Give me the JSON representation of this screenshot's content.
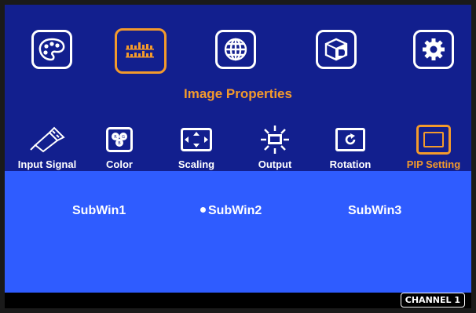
{
  "top_menu": {
    "items": [
      {
        "icon": "palette-icon"
      },
      {
        "icon": "image-properties-icon",
        "active": true
      },
      {
        "icon": "globe-icon"
      },
      {
        "icon": "3d-cube-icon"
      },
      {
        "icon": "gear-icon"
      }
    ],
    "caption": "Image Properties"
  },
  "sub_menu": {
    "items": [
      {
        "label": "Input Signal",
        "icon": "usb-plug-icon"
      },
      {
        "label": "Color",
        "icon": "color-balls-icon"
      },
      {
        "label": "Scaling",
        "icon": "scaling-arrows-icon"
      },
      {
        "label": "Output",
        "icon": "output-light-icon"
      },
      {
        "label": "Rotation",
        "icon": "rotation-icon"
      },
      {
        "label": "PIP Setting",
        "icon": "pip-icon",
        "active": true
      }
    ]
  },
  "panel": {
    "options": [
      "SubWin1",
      "SubWin2",
      "SubWin3"
    ],
    "selected": "SubWin2"
  },
  "status": {
    "channel": "CHANNEL 1"
  },
  "colors": {
    "background": "#121f8e",
    "accent": "#f39a2c",
    "panel": "#2f5cff"
  }
}
